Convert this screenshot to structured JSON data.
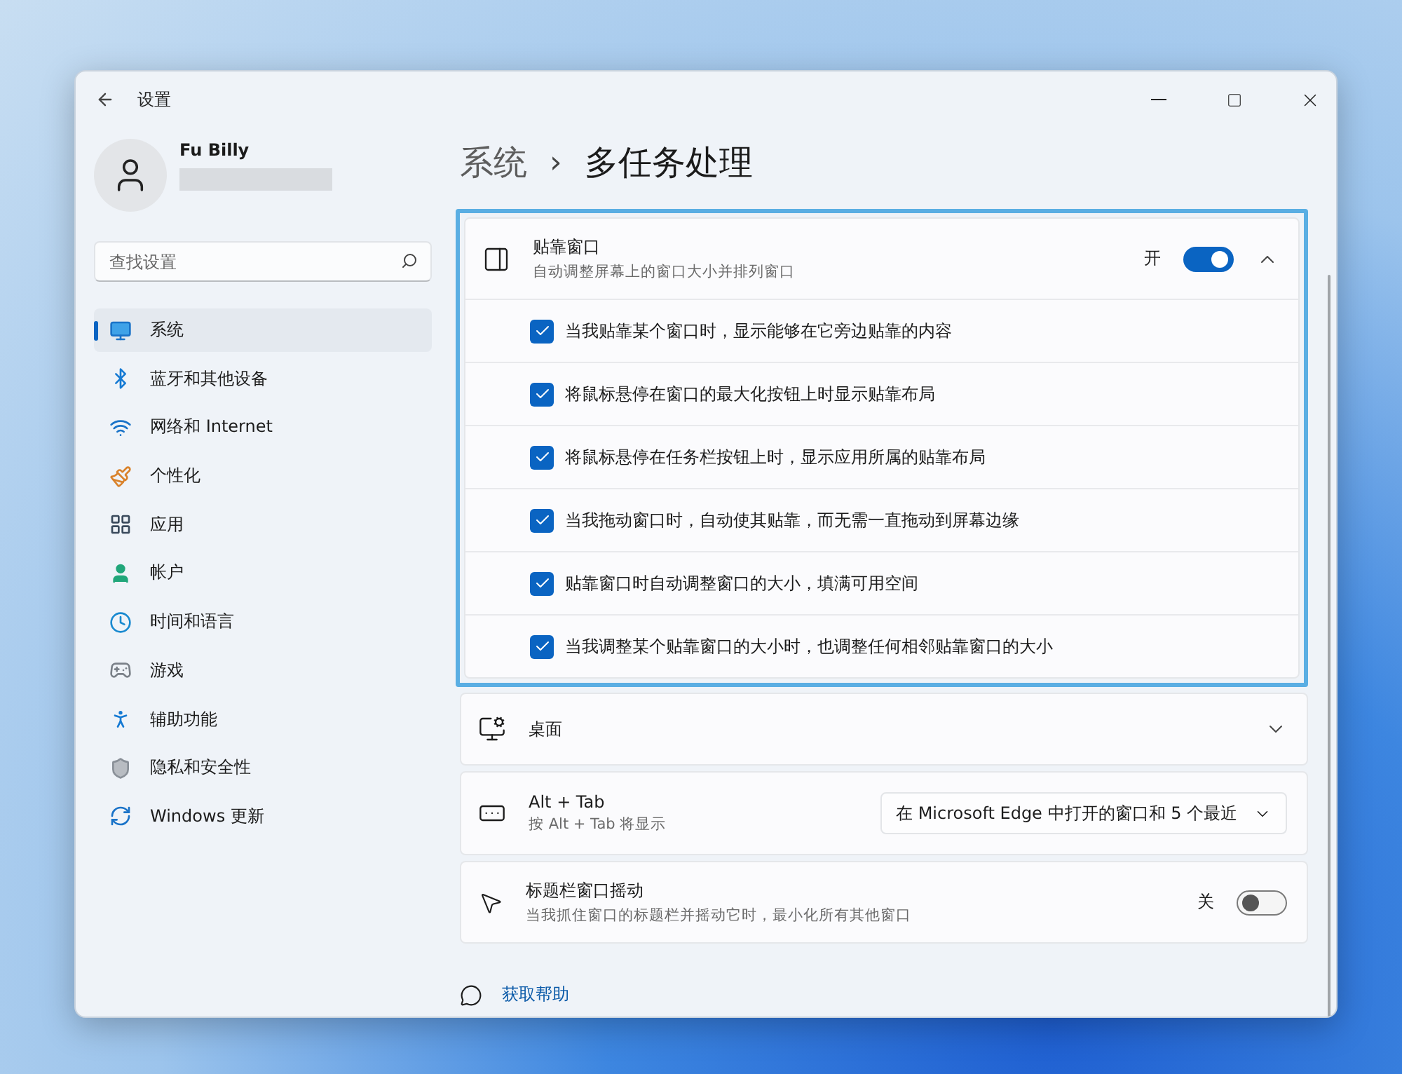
{
  "window": {
    "title": "设置"
  },
  "user": {
    "name": "Fu Billy"
  },
  "search": {
    "placeholder": "查找设置"
  },
  "nav": [
    {
      "label": "系统",
      "kind": "system",
      "selected": true
    },
    {
      "label": "蓝牙和其他设备",
      "kind": "bluetooth",
      "selected": false
    },
    {
      "label": "网络和 Internet",
      "kind": "network",
      "selected": false
    },
    {
      "label": "个性化",
      "kind": "personalize",
      "selected": false
    },
    {
      "label": "应用",
      "kind": "apps",
      "selected": false
    },
    {
      "label": "帐户",
      "kind": "accounts",
      "selected": false
    },
    {
      "label": "时间和语言",
      "kind": "time",
      "selected": false
    },
    {
      "label": "游戏",
      "kind": "gaming",
      "selected": false
    },
    {
      "label": "辅助功能",
      "kind": "accessibility",
      "selected": false
    },
    {
      "label": "隐私和安全性",
      "kind": "privacy",
      "selected": false
    },
    {
      "label": "Windows 更新",
      "kind": "update",
      "selected": false
    }
  ],
  "breadcrumb": {
    "parent": "系统",
    "separator": "›",
    "current": "多任务处理"
  },
  "snap": {
    "title": "贴靠窗口",
    "subtitle": "自动调整屏幕上的窗口大小并排列窗口",
    "state_label": "开",
    "on": true,
    "expanded": true,
    "options": [
      {
        "label": "当我贴靠某个窗口时，显示能够在它旁边贴靠的内容",
        "checked": true
      },
      {
        "label": "将鼠标悬停在窗口的最大化按钮上时显示贴靠布局",
        "checked": true
      },
      {
        "label": "将鼠标悬停在任务栏按钮上时，显示应用所属的贴靠布局",
        "checked": true
      },
      {
        "label": "当我拖动窗口时，自动使其贴靠，而无需一直拖动到屏幕边缘",
        "checked": true
      },
      {
        "label": "贴靠窗口时自动调整窗口的大小，填满可用空间",
        "checked": true
      },
      {
        "label": "当我调整某个贴靠窗口的大小时，也调整任何相邻贴靠窗口的大小",
        "checked": true
      }
    ]
  },
  "desktop": {
    "title": "桌面",
    "expanded": false
  },
  "alt_tab": {
    "title": "Alt + Tab",
    "subtitle": "按 Alt + Tab 将显示",
    "value": "在 Microsoft Edge 中打开的窗口和 5 个最近"
  },
  "shake": {
    "title": "标题栏窗口摇动",
    "subtitle": "当我抓住窗口的标题栏并摇动它时，最小化所有其他窗口",
    "state_label": "关",
    "on": false
  },
  "help": {
    "label": "获取帮助"
  }
}
